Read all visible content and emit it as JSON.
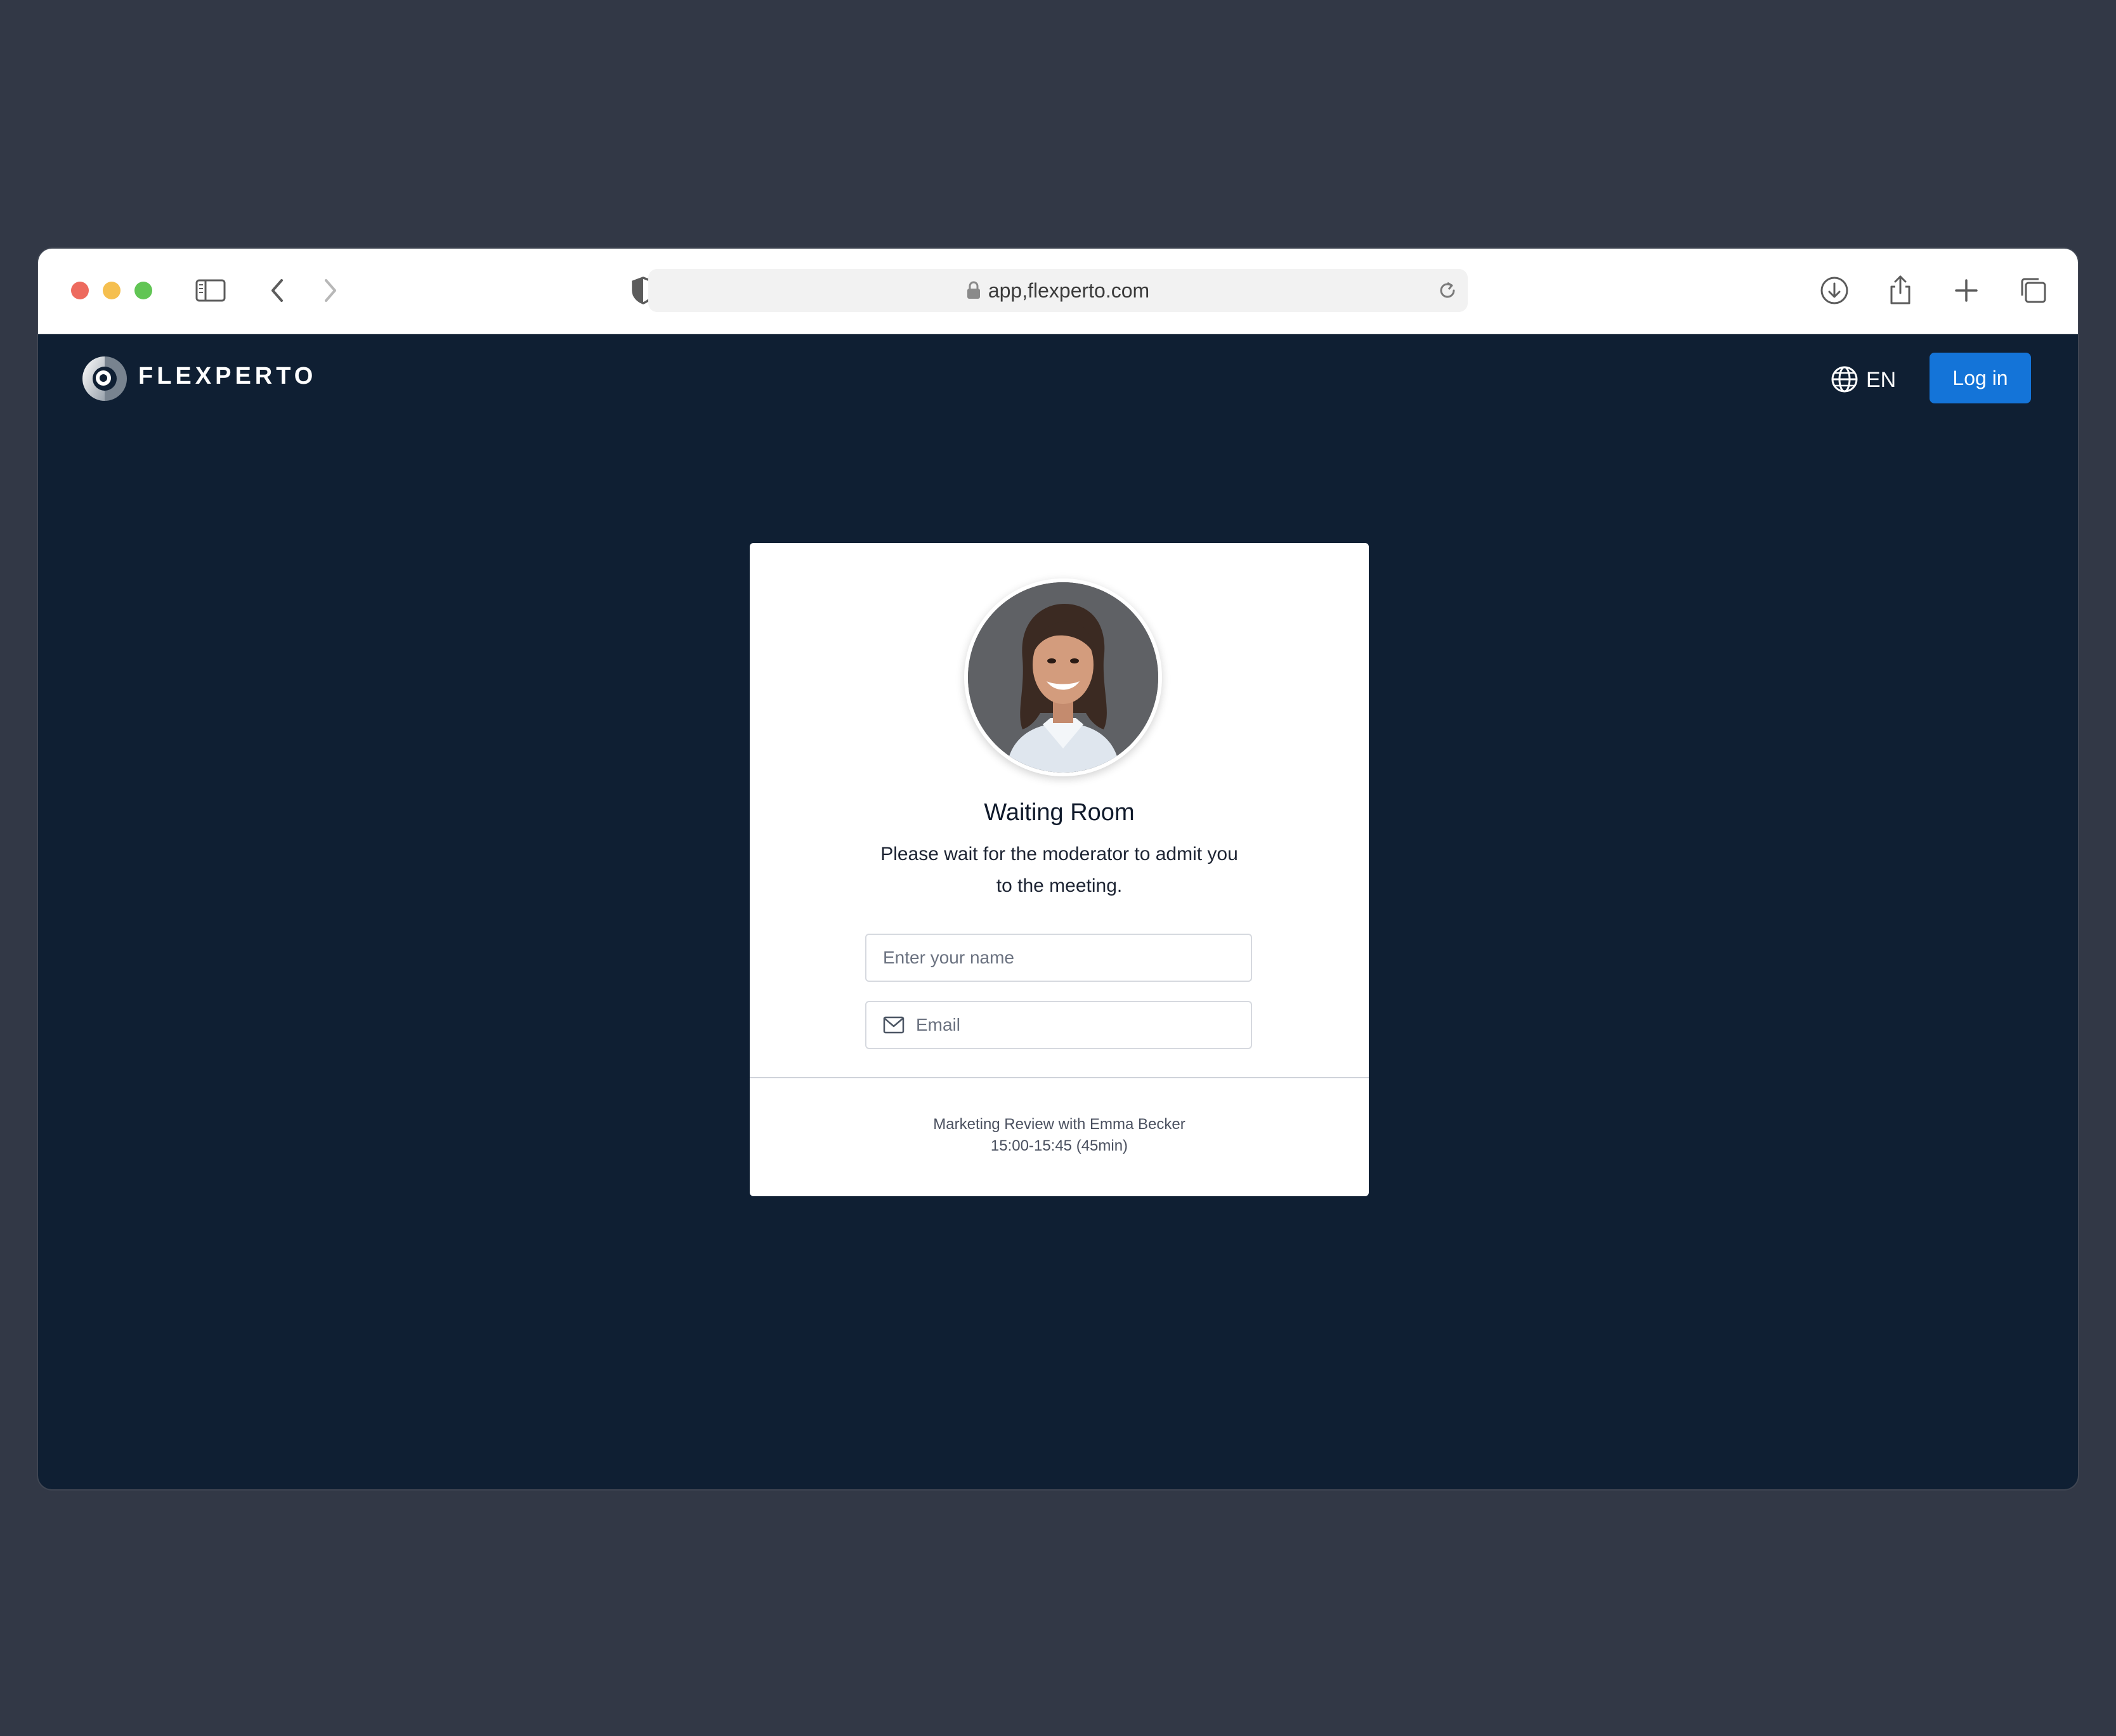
{
  "browser": {
    "url": "app,flexperto.com"
  },
  "header": {
    "brand": "FLEXPERTO",
    "language": "EN",
    "login_label": "Log in"
  },
  "card": {
    "title": "Waiting Room",
    "description": "Please wait for the moderator to admit you to the meeting.",
    "name_placeholder": "Enter your name",
    "email_placeholder": "Email",
    "meeting_title": "Marketing Review with Emma Becker",
    "meeting_time": "15:00-15:45 (45min)"
  },
  "colors": {
    "page_bg": "#323846",
    "app_bg": "#0f1f33",
    "accent": "#1474d8",
    "card_bg": "#ffffff"
  },
  "icons": [
    "sidebar-icon",
    "back-icon",
    "forward-icon",
    "shield-icon",
    "lock-icon",
    "reload-icon",
    "download-icon",
    "share-icon",
    "new-tab-icon",
    "tabs-overview-icon",
    "globe-icon",
    "mail-icon"
  ]
}
